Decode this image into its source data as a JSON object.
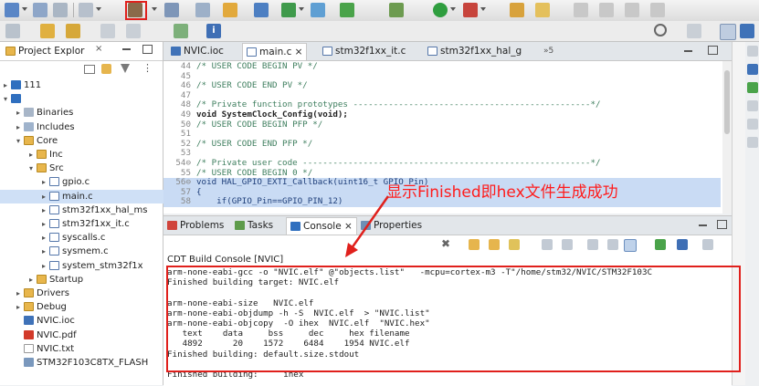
{
  "colors": {
    "accent": "#2f6fbf",
    "annotation": "#e0201c",
    "comment": "#3f7f5f",
    "keyword": "#7f0055",
    "highlight": "#c9dbf4"
  },
  "toolbar": {
    "icons": [
      "new-file-icon",
      "save-icon",
      "print-icon",
      "undo-icon",
      "build-hammer-icon",
      "debug-icon",
      "run-icon",
      "search-icon",
      "open-perspective-icon"
    ]
  },
  "project_explorer": {
    "tab_label": "Project Explor",
    "items": [
      {
        "label": "111",
        "kind": "project",
        "indent": 0,
        "twisty": "closed"
      },
      {
        "label": "",
        "kind": "project",
        "indent": 0,
        "twisty": "open"
      },
      {
        "label": "Binaries",
        "kind": "binaries",
        "indent": 1,
        "twisty": "closed"
      },
      {
        "label": "Includes",
        "kind": "includes",
        "indent": 1,
        "twisty": "closed"
      },
      {
        "label": "Core",
        "kind": "folder",
        "indent": 1,
        "twisty": "open"
      },
      {
        "label": "Inc",
        "kind": "folder",
        "indent": 2,
        "twisty": "closed"
      },
      {
        "label": "Src",
        "kind": "folder",
        "indent": 2,
        "twisty": "open"
      },
      {
        "label": "gpio.c",
        "kind": "cfile",
        "indent": 3,
        "twisty": "closed"
      },
      {
        "label": "main.c",
        "kind": "cfile",
        "indent": 3,
        "twisty": "closed",
        "selected": true
      },
      {
        "label": "stm32f1xx_hal_ms",
        "kind": "cfile",
        "indent": 3,
        "twisty": "closed"
      },
      {
        "label": "stm32f1xx_it.c",
        "kind": "cfile",
        "indent": 3,
        "twisty": "closed"
      },
      {
        "label": "syscalls.c",
        "kind": "cfile",
        "indent": 3,
        "twisty": "closed"
      },
      {
        "label": "sysmem.c",
        "kind": "cfile",
        "indent": 3,
        "twisty": "closed"
      },
      {
        "label": "system_stm32f1x",
        "kind": "cfile",
        "indent": 3,
        "twisty": "closed"
      },
      {
        "label": "Startup",
        "kind": "folder",
        "indent": 2,
        "twisty": "closed"
      },
      {
        "label": "Drivers",
        "kind": "folder",
        "indent": 1,
        "twisty": "closed"
      },
      {
        "label": "Debug",
        "kind": "folder",
        "indent": 1,
        "twisty": "closed"
      },
      {
        "label": "NVIC.ioc",
        "kind": "ioc",
        "indent": 1,
        "twisty": ""
      },
      {
        "label": "NVIC.pdf",
        "kind": "pdf",
        "indent": 1,
        "twisty": ""
      },
      {
        "label": "NVIC.txt",
        "kind": "txt",
        "indent": 1,
        "twisty": ""
      },
      {
        "label": "STM32F103C8TX_FLASH",
        "kind": "ld",
        "indent": 1,
        "twisty": ""
      }
    ]
  },
  "editor": {
    "tabs": [
      {
        "label": "NVIC.ioc",
        "kind": "ioc"
      },
      {
        "label": "main.c ×",
        "kind": "c",
        "active": true
      },
      {
        "label": "stm32f1xx_it.c",
        "kind": "c"
      },
      {
        "label": "stm32f1xx_hal_g",
        "kind": "c"
      },
      {
        "label": "»5",
        "kind": "more"
      }
    ],
    "lines": [
      {
        "n": "44",
        "text": "/* USER CODE BEGIN PV */",
        "cls": "cmt"
      },
      {
        "n": "45",
        "text": "",
        "cls": ""
      },
      {
        "n": "46",
        "text": "/* USER CODE END PV */",
        "cls": "cmt"
      },
      {
        "n": "47",
        "text": "",
        "cls": ""
      },
      {
        "n": "48",
        "text": "/* Private function prototypes -----------------------------------------------*/",
        "cls": "cmt"
      },
      {
        "n": "49",
        "text": "void SystemClock_Config(void);",
        "cls": "proto"
      },
      {
        "n": "50",
        "text": "/* USER CODE BEGIN PFP */",
        "cls": "cmt"
      },
      {
        "n": "51",
        "text": "",
        "cls": ""
      },
      {
        "n": "52",
        "text": "/* USER CODE END PFP */",
        "cls": "cmt"
      },
      {
        "n": "53",
        "text": "",
        "cls": ""
      },
      {
        "n": "54⊖",
        "text": "/* Private user code ---------------------------------------------------------*/",
        "cls": "cmt"
      },
      {
        "n": "55",
        "text": "/* USER CODE BEGIN 0 */",
        "cls": "cmt"
      },
      {
        "n": "56⊖",
        "text": "void HAL_GPIO_EXTI_Callback(uint16_t GPIO_Pin)",
        "cls": "hl"
      },
      {
        "n": "57",
        "text": "{",
        "cls": "hl"
      },
      {
        "n": "58",
        "text": "    if(GPIO_Pin==GPIO_PIN_12)",
        "cls": "hl"
      }
    ]
  },
  "annotation": {
    "text": "显示Finished即hex文件生成成功"
  },
  "console": {
    "tabs": [
      "Problems",
      "Tasks",
      "Console ×",
      "Properties"
    ],
    "title": "CDT Build Console [NVIC]",
    "lines": [
      "arm-none-eabi-gcc -o \"NVIC.elf\" @\"objects.list\"   -mcpu=cortex-m3 -T\"/home/stm32/NVIC/STM32F103C",
      "Finished building target: NVIC.elf",
      "",
      "arm-none-eabi-size   NVIC.elf",
      "arm-none-eabi-objdump -h -S  NVIC.elf  > \"NVIC.list\"",
      "arm-none-eabi-objcopy  -O ihex  NVIC.elf  \"NVIC.hex\"",
      "   text    data     bss     dec     hex filename",
      "   4892      20    1572    6484    1954 NVIC.elf",
      "Finished building: default.size.stdout",
      "",
      "Finished building:     ihex"
    ]
  }
}
